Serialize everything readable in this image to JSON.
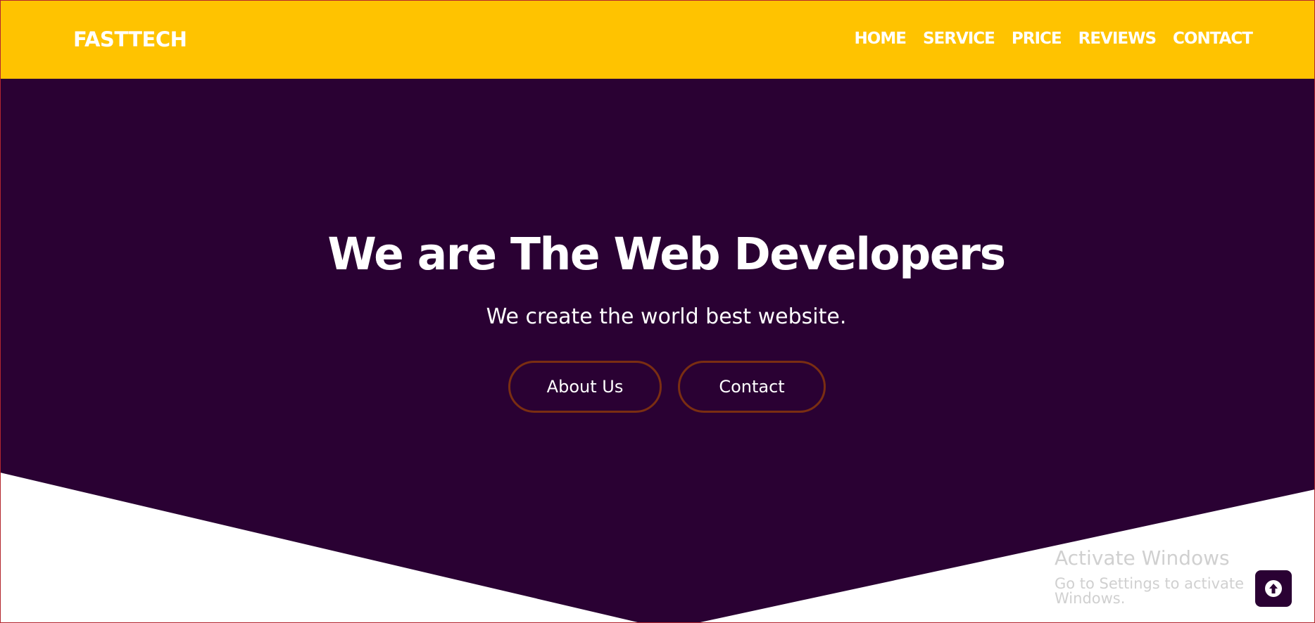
{
  "header": {
    "brand": "FASTTECH",
    "nav": [
      {
        "label": "HOME"
      },
      {
        "label": "SERVICE"
      },
      {
        "label": "PRICE"
      },
      {
        "label": "REVIEWS"
      },
      {
        "label": "CONTACT"
      }
    ]
  },
  "hero": {
    "title": "We are The Web Developers",
    "subtitle": "We create the world best website.",
    "buttons": {
      "about": "About Us",
      "contact": "Contact"
    }
  },
  "watermark": {
    "title": "Activate Windows",
    "subtitle": "Go to Settings to activate Windows."
  },
  "scroll_top": {
    "icon": "arrow-up-icon"
  },
  "colors": {
    "navbar": "#ffc300",
    "hero_background": "#2a0133",
    "button_border": "#7a2e12",
    "text": "#ffffff"
  }
}
